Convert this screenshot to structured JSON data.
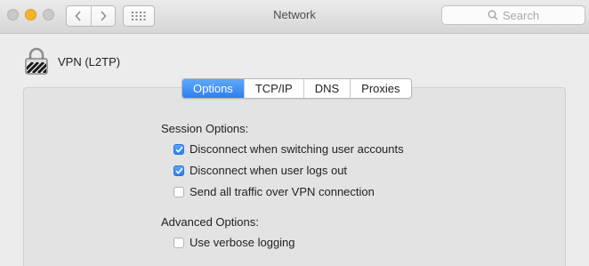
{
  "window": {
    "title": "Network"
  },
  "toolbar": {
    "back_icon": "chevron-left-icon",
    "forward_icon": "chevron-right-icon",
    "grid_icon": "show-all-grid-icon",
    "search_placeholder": "Search"
  },
  "connection": {
    "name": "VPN (L2TP)",
    "icon": "vpn-lock-icon"
  },
  "tabs": [
    {
      "label": "Options",
      "active": true
    },
    {
      "label": "TCP/IP",
      "active": false
    },
    {
      "label": "DNS",
      "active": false
    },
    {
      "label": "Proxies",
      "active": false
    }
  ],
  "session_options": {
    "heading": "Session Options:",
    "items": [
      {
        "label": "Disconnect when switching user accounts",
        "checked": true
      },
      {
        "label": "Disconnect when user logs out",
        "checked": true
      },
      {
        "label": "Send all traffic over VPN connection",
        "checked": false
      }
    ]
  },
  "advanced_options": {
    "heading": "Advanced Options:",
    "items": [
      {
        "label": "Use verbose logging",
        "checked": false
      }
    ]
  },
  "colors": {
    "accent": "#2f7ef0",
    "minimize": "#f5b32a",
    "window_bg": "#ececec"
  }
}
